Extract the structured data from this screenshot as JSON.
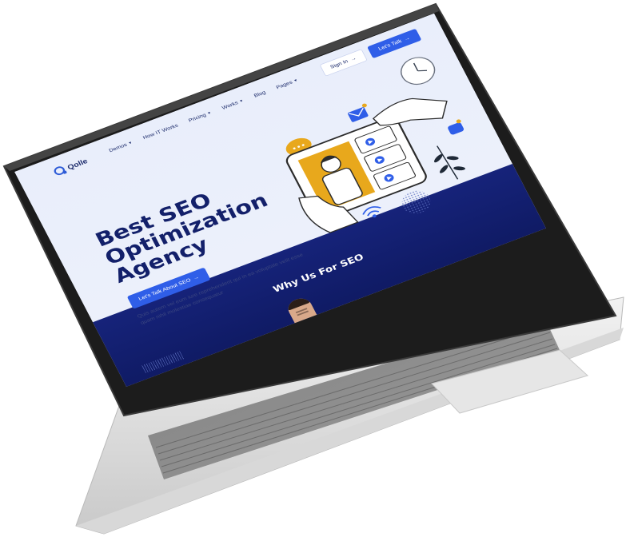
{
  "brand": {
    "name": "Qolle"
  },
  "nav": {
    "items": [
      {
        "label": "Demos",
        "has_dropdown": true
      },
      {
        "label": "How IT Works",
        "has_dropdown": false
      },
      {
        "label": "Pricing",
        "has_dropdown": true
      },
      {
        "label": "Works",
        "has_dropdown": true
      },
      {
        "label": "Blog",
        "has_dropdown": false
      },
      {
        "label": "Pages",
        "has_dropdown": true
      }
    ],
    "sign_in_label": "Sign In",
    "cta_label": "Let's Talk"
  },
  "hero": {
    "title_line1": "Best SEO",
    "title_line2": "Optimization",
    "title_line3": "Agency",
    "button_label": "Let's Talk About SEO",
    "text": "Quis autem vel eum iure reprehenderit qui in ea voluptate velit esse quam nihil molestiae consequatur"
  },
  "section": {
    "title": "Why Us For SEO"
  },
  "icons": {
    "arrow": "arrow-right-icon",
    "caret": "chevron-down-icon",
    "chat": "chat-bubble-icon",
    "mail": "mail-icon",
    "clock": "clock-icon",
    "wifi": "wifi-icon",
    "play": "play-icon"
  },
  "colors": {
    "primary": "#2f5ee8",
    "navy": "#13206a",
    "band": "#16237a",
    "accent_yellow": "#e8a81c",
    "background": "#e9eefb"
  }
}
